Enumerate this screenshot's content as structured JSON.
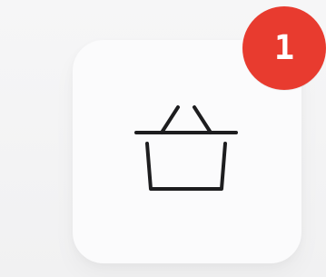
{
  "cart": {
    "icon": "basket-icon",
    "badge_count": "1",
    "badge_color": "#e83b2f"
  }
}
